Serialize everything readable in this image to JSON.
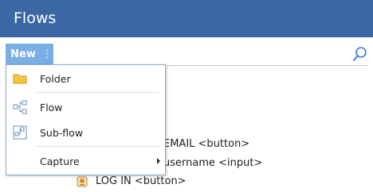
{
  "header": {
    "title": "Flows"
  },
  "toolbar": {
    "new_label": "New",
    "more_label": "⋮"
  },
  "menu": {
    "items": [
      {
        "label": "Folder",
        "icon": "folder-icon"
      },
      {
        "label": "Flow",
        "icon": "flow-icon"
      },
      {
        "label": "Sub-flow",
        "icon": "subflow-icon"
      },
      {
        "label": "Capture",
        "icon": "",
        "has_submenu": true
      }
    ]
  },
  "tree": {
    "rows": [
      {
        "label": "EMAIL <button>"
      },
      {
        "label": "username <input>"
      },
      {
        "label": "LOG IN <button>"
      }
    ]
  },
  "colors": {
    "header_bg": "#3a68a5",
    "new_button_bg": "#7aaee4",
    "menu_border": "#8aaed6"
  }
}
